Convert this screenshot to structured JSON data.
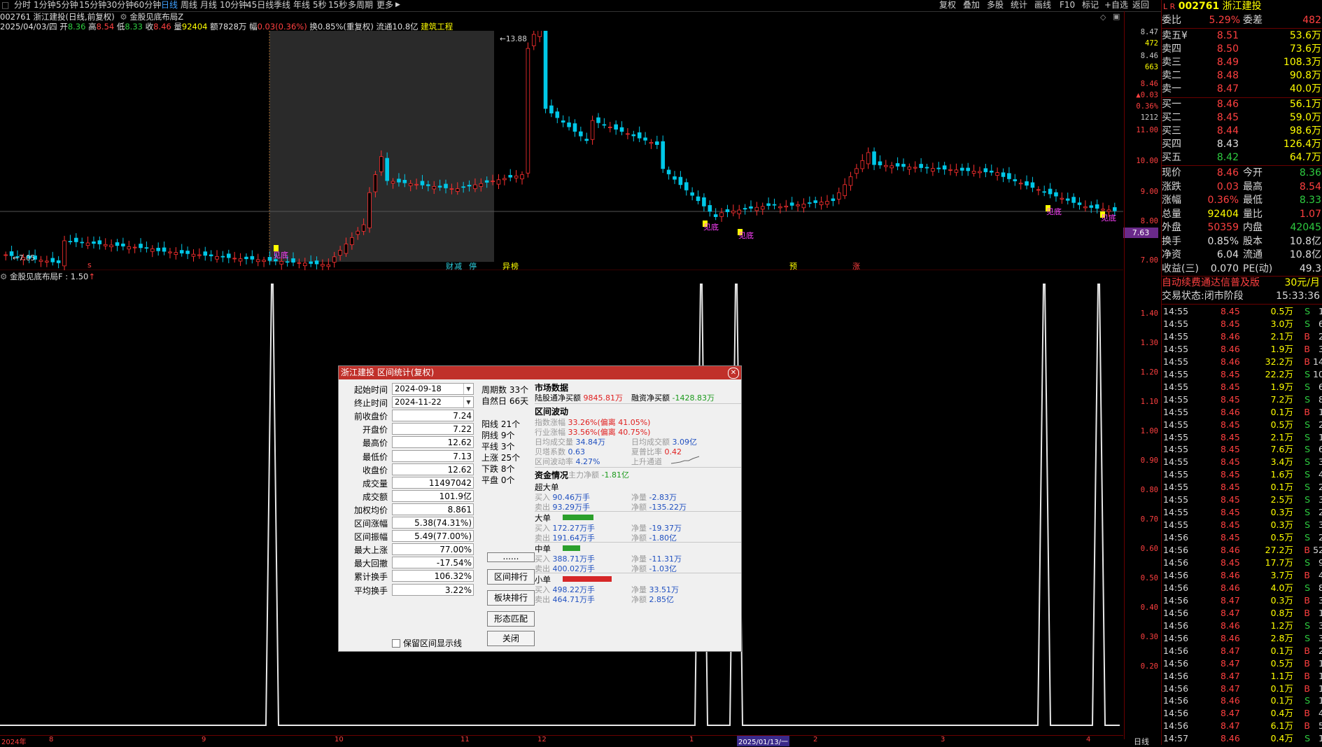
{
  "toolbar": {
    "periods": [
      "分时",
      "1分钟",
      "5分钟",
      "15分钟",
      "30分钟",
      "60分钟",
      "日线",
      "周线",
      "月线",
      "10分钟",
      "45日线",
      "季线",
      "年线",
      "5秒",
      "15秒",
      "多周期",
      "更多"
    ],
    "active": "日线",
    "right_buttons": [
      "复权",
      "叠加",
      "多股",
      "统计",
      "画线",
      "F10",
      "标记",
      "+自选",
      "返回"
    ]
  },
  "header": {
    "title": "002761 浙江建投(日线,前复权)",
    "indicator_name": "金股见底布局Z",
    "date": "2025/04/03/四",
    "open_label": "开",
    "open": "8.36",
    "high_label": "高",
    "high": "8.54",
    "low_label": "低",
    "low": "8.33",
    "close_label": "收",
    "close": "8.46",
    "vol_label": "量",
    "vol": "92404",
    "amount_label": "额",
    "amount": "7828万",
    "chg_label": "幅",
    "chg": "0.03(0.36%)",
    "turn": "换0.85%(重复权)",
    "float": "流通10.8亿",
    "sector": "建筑工程"
  },
  "main_chart": {
    "high_mark": "13.88",
    "low_mark": "7.05",
    "last_price_tag": "7.63",
    "signal_label": "见底",
    "event_tags": [
      {
        "text": "财",
        "color": "cyan"
      },
      {
        "text": "减",
        "color": "cyan"
      },
      {
        "text": "停",
        "color": "cyan"
      },
      {
        "text": "异",
        "color": "yellow"
      },
      {
        "text": "榜",
        "color": "yellow"
      },
      {
        "text": "预",
        "color": "yellow"
      },
      {
        "text": "涨",
        "color": "red"
      }
    ],
    "axis": [
      "11.00",
      "10.00",
      "9.00",
      "8.00",
      "7.00"
    ],
    "axis_top": [
      "8.47",
      "472",
      "8.46",
      "663",
      "8.46",
      "▲0.03",
      "0.36%",
      "1212"
    ]
  },
  "indicator": {
    "title": "金股见底布局F : 1.50",
    "axis": [
      "1.40",
      "1.30",
      "1.20",
      "1.10",
      "1.00",
      "0.90",
      "0.80",
      "0.70",
      "0.60",
      "0.50",
      "0.40",
      "0.30",
      "0.20"
    ]
  },
  "bottom_axis": {
    "labels": [
      "2024年",
      "8",
      "9",
      "10",
      "11",
      "12",
      "1",
      "2025/01/13/一",
      "2",
      "3",
      "4"
    ],
    "right": "日线"
  },
  "quote": {
    "code": "002761",
    "name": "浙江建投",
    "webi_label": "委比",
    "webi": "5.29%",
    "weicha_label": "委差",
    "weicha": "482",
    "sells": [
      {
        "label": "卖五¥",
        "price": "8.51",
        "vol": "53.6万"
      },
      {
        "label": "卖四",
        "price": "8.50",
        "vol": "73.6万"
      },
      {
        "label": "卖三",
        "price": "8.49",
        "vol": "108.3万"
      },
      {
        "label": "卖二",
        "price": "8.48",
        "vol": "90.8万"
      },
      {
        "label": "卖一",
        "price": "8.47",
        "vol": "40.0万"
      }
    ],
    "buys": [
      {
        "label": "买一",
        "price": "8.46",
        "vol": "56.1万"
      },
      {
        "label": "买二",
        "price": "8.45",
        "vol": "59.0万"
      },
      {
        "label": "买三",
        "price": "8.44",
        "vol": "98.6万"
      },
      {
        "label": "买四",
        "price": "8.43",
        "vol": "126.4万"
      },
      {
        "label": "买五",
        "price": "8.42",
        "vol": "64.7万"
      }
    ],
    "stats": [
      {
        "l1": "现价",
        "v1": "8.46",
        "c1": "r",
        "l2": "今开",
        "v2": "8.36",
        "c2": "g"
      },
      {
        "l1": "涨跌",
        "v1": "0.03",
        "c1": "r",
        "l2": "最高",
        "v2": "8.54",
        "c2": "r"
      },
      {
        "l1": "涨幅",
        "v1": "0.36%",
        "c1": "r",
        "l2": "最低",
        "v2": "8.33",
        "c2": "g"
      },
      {
        "l1": "总量",
        "v1": "92404",
        "c1": "y",
        "l2": "量比",
        "v2": "1.07",
        "c2": "r"
      },
      {
        "l1": "外盘",
        "v1": "50359",
        "c1": "r",
        "l2": "内盘",
        "v2": "42045",
        "c2": "g"
      },
      {
        "l1": "换手",
        "v1": "0.85%",
        "c1": "w",
        "l2": "股本",
        "v2": "10.8亿",
        "c2": "w"
      },
      {
        "l1": "净资",
        "v1": "6.04",
        "c1": "w",
        "l2": "流通",
        "v2": "10.8亿",
        "c2": "w"
      },
      {
        "l1": "收益(三)",
        "v1": "0.070",
        "c1": "w",
        "l2": "PE(动)",
        "v2": "49.3",
        "c2": "w"
      }
    ],
    "promo": "自动续费通达信普及版",
    "promo_price": "30元/月",
    "trade_status": "交易状态:闭市阶段",
    "trade_time": "15:33:36",
    "ticks": [
      [
        "14:55",
        "8.45",
        "0.5万",
        "S",
        "1"
      ],
      [
        "14:55",
        "8.45",
        "3.0万",
        "S",
        "6"
      ],
      [
        "14:55",
        "8.46",
        "2.1万",
        "B",
        "2"
      ],
      [
        "14:55",
        "8.46",
        "1.9万",
        "B",
        "3"
      ],
      [
        "14:55",
        "8.46",
        "32.2万",
        "B",
        "14"
      ],
      [
        "14:55",
        "8.45",
        "22.2万",
        "S",
        "10"
      ],
      [
        "14:55",
        "8.45",
        "1.9万",
        "S",
        "6"
      ],
      [
        "14:55",
        "8.45",
        "7.2万",
        "S",
        "8"
      ],
      [
        "14:55",
        "8.46",
        "0.1万",
        "B",
        "1"
      ],
      [
        "14:55",
        "8.45",
        "0.5万",
        "S",
        "2"
      ],
      [
        "14:55",
        "8.45",
        "2.1万",
        "S",
        "1"
      ],
      [
        "14:55",
        "8.45",
        "7.6万",
        "S",
        "6"
      ],
      [
        "14:55",
        "8.45",
        "3.4万",
        "S",
        "3"
      ],
      [
        "14:55",
        "8.45",
        "1.6万",
        "S",
        "4"
      ],
      [
        "14:55",
        "8.45",
        "0.1万",
        "S",
        "2"
      ],
      [
        "14:55",
        "8.45",
        "2.5万",
        "S",
        "3"
      ],
      [
        "14:55",
        "8.45",
        "0.3万",
        "S",
        "2"
      ],
      [
        "14:55",
        "8.45",
        "0.3万",
        "S",
        "3"
      ],
      [
        "14:56",
        "8.45",
        "0.5万",
        "S",
        "2"
      ],
      [
        "14:56",
        "8.46",
        "27.2万",
        "B",
        "52"
      ],
      [
        "14:56",
        "8.45",
        "17.7万",
        "S",
        "9"
      ],
      [
        "14:56",
        "8.46",
        "3.7万",
        "B",
        "4"
      ],
      [
        "14:56",
        "8.46",
        "4.0万",
        "S",
        "8"
      ],
      [
        "14:56",
        "8.47",
        "0.3万",
        "B",
        "3"
      ],
      [
        "14:56",
        "8.47",
        "0.8万",
        "B",
        "1"
      ],
      [
        "14:56",
        "8.46",
        "1.2万",
        "S",
        "3"
      ],
      [
        "14:56",
        "8.46",
        "2.8万",
        "S",
        "3"
      ],
      [
        "14:56",
        "8.47",
        "0.1万",
        "B",
        "2"
      ],
      [
        "14:56",
        "8.47",
        "0.5万",
        "B",
        "1"
      ],
      [
        "14:56",
        "8.47",
        "1.1万",
        "B",
        "1"
      ],
      [
        "14:56",
        "8.47",
        "0.1万",
        "B",
        "1"
      ],
      [
        "14:56",
        "8.46",
        "0.1万",
        "S",
        "1"
      ],
      [
        "14:56",
        "8.47",
        "0.4万",
        "B",
        "4"
      ],
      [
        "14:56",
        "8.47",
        "6.1万",
        "B",
        "5"
      ],
      [
        "14:57",
        "8.46",
        "0.4万",
        "S",
        "1"
      ]
    ]
  },
  "dialog": {
    "title": "浙江建投 区间统计(复权)",
    "fields": [
      {
        "label": "起始时间",
        "value": "2024-09-18",
        "select": true
      },
      {
        "label": "终止时间",
        "value": "2024-11-22",
        "select": true
      },
      {
        "label": "前收盘价",
        "value": "7.24"
      },
      {
        "label": "开盘价",
        "value": "7.22"
      },
      {
        "label": "最高价",
        "value": "12.62"
      },
      {
        "label": "最低价",
        "value": "7.13"
      },
      {
        "label": "收盘价",
        "value": "12.62"
      },
      {
        "label": "成交量",
        "value": "11497042"
      },
      {
        "label": "成交额",
        "value": "101.9亿"
      },
      {
        "label": "加权均价",
        "value": "8.861"
      },
      {
        "label": "区间涨幅",
        "value": "5.38(74.31%)"
      },
      {
        "label": "区间振幅",
        "value": "5.49(77.00%)"
      },
      {
        "label": "最大上涨",
        "value": "77.00%"
      },
      {
        "label": "最大回撤",
        "value": "-17.54%"
      },
      {
        "label": "累计换手",
        "value": "106.32%"
      },
      {
        "label": "平均换手",
        "value": "3.22%"
      }
    ],
    "checkbox_label": "保留区间显示线",
    "period_count": "周期数 33个",
    "natural_days": "自然日 66天",
    "counts": [
      "阳线 21个",
      "阴线 9个",
      "平线 3个",
      "上涨 25个",
      "下跌 8个",
      "平盘 0个"
    ],
    "buttons": [
      "......",
      "区间排行",
      "板块排行",
      "形态匹配",
      "关闭"
    ],
    "market_title": "市场数据",
    "hsgt_label": "陆股通净买额",
    "hsgt": "9845.81万",
    "margin_label": "融资净买额",
    "margin": "-1428.83万",
    "wave_title": "区间波动",
    "idx_label": "指数涨幅",
    "idx": "33.26%",
    "idx_dev": "(偏离 41.05%)",
    "ind_label": "行业涨幅",
    "ind": "33.56%",
    "ind_dev": "(偏离 40.75%)",
    "davg_label": "日均成交量",
    "davg": "34.84万",
    "damt_label": "日均成交额",
    "damt": "3.09亿",
    "beta_label": "贝塔系数",
    "beta": "0.63",
    "sharpe_label": "夏普比率",
    "sharpe": "0.42",
    "vol_label": "区间波动率",
    "vol": "4.27%",
    "channel": "上升通道",
    "fund_title": "资金情况",
    "main_net_label": "主力净额",
    "main_net": "-1.81亿",
    "groups": [
      {
        "name": "超大单",
        "bar": "",
        "buy": "90.46万手",
        "net_vol": "-2.83万",
        "sell": "93.29万手",
        "net_amt": "-135.22万"
      },
      {
        "name": "大单",
        "bar": "green",
        "buy": "172.27万手",
        "net_vol": "-19.37万",
        "sell": "191.64万手",
        "net_amt": "-1.80亿"
      },
      {
        "name": "中单",
        "bar": "green",
        "buy": "388.71万手",
        "net_vol": "-11.31万",
        "sell": "400.02万手",
        "net_amt": "-1.03亿"
      },
      {
        "name": "小单",
        "bar": "red",
        "buy": "498.22万手",
        "net_vol": "33.51万",
        "sell": "464.71万手",
        "net_amt": "2.85亿"
      }
    ],
    "buy_label": "买入",
    "sell_label": "卖出",
    "net_vol_label": "净量",
    "net_amt_label": "净额"
  }
}
